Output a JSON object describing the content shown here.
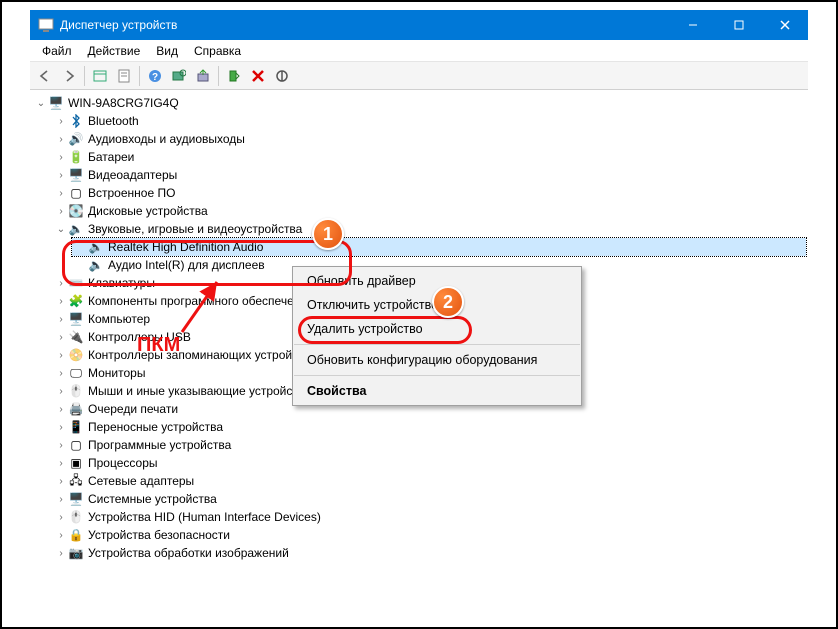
{
  "window": {
    "title": "Диспетчер устройств"
  },
  "menu": {
    "file": "Файл",
    "action": "Действие",
    "view": "Вид",
    "help": "Справка"
  },
  "tree": {
    "root": "WIN-9A8CRG7IG4Q",
    "bluetooth": "Bluetooth",
    "audio_io": "Аудиовходы и аудиовыходы",
    "batteries": "Батареи",
    "video_adapters": "Видеоадаптеры",
    "firmware": "Встроенное ПО",
    "disk_drives": "Дисковые устройства",
    "sound_game_video": "Звуковые, игровые и видеоустройства",
    "realtek": "Realtek High Definition Audio",
    "intel_display": "Аудио Intel(R) для дисплеев",
    "keyboards": "Клавиатуры",
    "software_components": "Компоненты программного обеспечения",
    "computer": "Компьютер",
    "usb_controllers": "Контроллеры USB",
    "storage_controllers": "Контроллеры запоминающих устройств",
    "monitors": "Мониторы",
    "mice_pointing": "Мыши и иные указывающие устройства",
    "print_queues": "Очереди печати",
    "portable_devices": "Переносные устройства",
    "software_devices": "Программные устройства",
    "processors": "Процессоры",
    "network_adapters": "Сетевые адаптеры",
    "system_devices": "Системные устройства",
    "hid": "Устройства HID (Human Interface Devices)",
    "security_devices": "Устройства безопасности",
    "imaging_devices": "Устройства обработки изображений"
  },
  "context_menu": {
    "update_driver": "Обновить драйвер",
    "disable_device": "Отключить устройство",
    "uninstall_device": "Удалить устройство",
    "scan_hardware": "Обновить конфигурацию оборудования",
    "properties": "Свойства"
  },
  "annotations": {
    "badge1": "1",
    "badge2": "2",
    "pkm": "ПКМ"
  }
}
